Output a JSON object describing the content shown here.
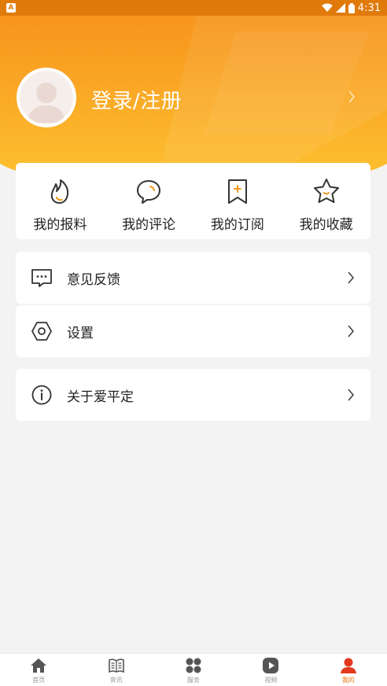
{
  "status_bar": {
    "time": "4:31",
    "left_badge": "A"
  },
  "profile": {
    "login_label": "登录/注册"
  },
  "quick_actions": [
    {
      "label": "我的报料",
      "icon": "flame-icon"
    },
    {
      "label": "我的评论",
      "icon": "comment-icon"
    },
    {
      "label": "我的订阅",
      "icon": "subscribe-icon"
    },
    {
      "label": "我的收藏",
      "icon": "star-icon"
    }
  ],
  "menu": {
    "feedback": "意见反馈",
    "settings": "设置",
    "about": "关于爱平定"
  },
  "tabbar": [
    {
      "label": "首页",
      "icon": "home-icon"
    },
    {
      "label": "资讯",
      "icon": "news-icon"
    },
    {
      "label": "服务",
      "icon": "services-icon"
    },
    {
      "label": "视频",
      "icon": "video-icon"
    },
    {
      "label": "我的",
      "icon": "profile-icon",
      "active": true
    }
  ],
  "colors": {
    "accent": "#e8740c",
    "header_top": "#f7941d",
    "header_bottom": "#fdc02f"
  }
}
